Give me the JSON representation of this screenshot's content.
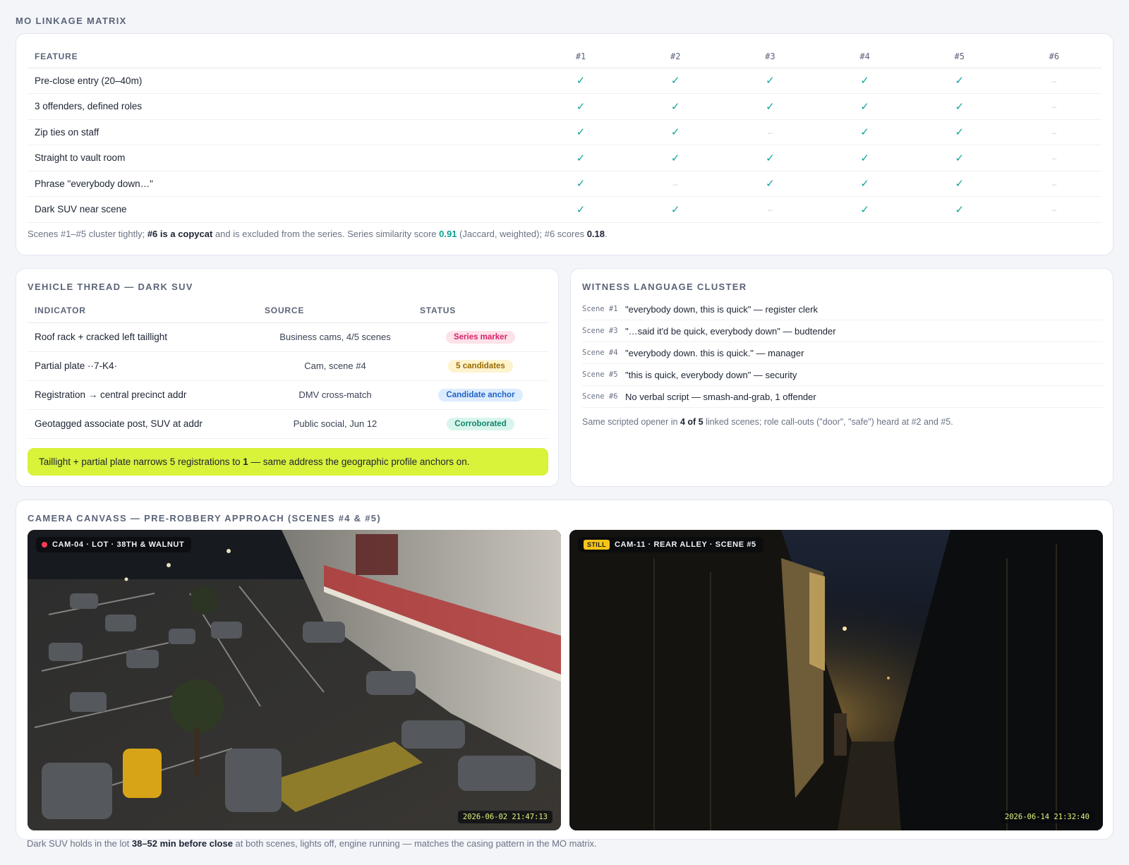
{
  "mo_matrix": {
    "title": "MO LINKAGE MATRIX",
    "columns": [
      "FEATURE",
      "#1",
      "#2",
      "#3",
      "#4",
      "#5",
      "#6"
    ],
    "rows": [
      {
        "feature": "Pre-close entry (20–40m)",
        "marks": [
          true,
          true,
          true,
          true,
          true,
          false
        ]
      },
      {
        "feature": "3 offenders, defined roles",
        "marks": [
          true,
          true,
          true,
          true,
          true,
          false
        ]
      },
      {
        "feature": "Zip ties on staff",
        "marks": [
          true,
          true,
          false,
          true,
          true,
          false
        ]
      },
      {
        "feature": "Straight to vault room",
        "marks": [
          true,
          true,
          true,
          true,
          true,
          false
        ]
      },
      {
        "feature": "Phrase \"everybody down…\"",
        "marks": [
          true,
          false,
          true,
          true,
          true,
          false
        ]
      },
      {
        "feature": "Dark SUV near scene",
        "marks": [
          true,
          true,
          false,
          true,
          true,
          false
        ]
      }
    ],
    "check_glyph": "✓",
    "dash_glyph": "–",
    "note": {
      "t1": "Scenes #1–#5 cluster tightly; ",
      "b1": "#6 is a copycat",
      "t2": " and is excluded from the series. Series similarity score ",
      "score": "0.91",
      "t3": " (Jaccard, weighted); #6 scores ",
      "score6": "0.18",
      "t4": "."
    }
  },
  "vehicle": {
    "title": "VEHICLE THREAD — DARK SUV",
    "headers": {
      "indicator": "INDICATOR",
      "source": "SOURCE",
      "status": "STATUS"
    },
    "rows": [
      {
        "indicator": "Roof rack + cracked left taillight",
        "source": "Business cams, 4/5 scenes",
        "status": "Series marker",
        "status_color": "pink"
      },
      {
        "indicator": "Partial plate ··7-K4·",
        "source": "Cam, scene #4",
        "status": "5 candidates",
        "status_color": "yellow"
      },
      {
        "indicator": "Registration → central precinct addr",
        "source": "DMV cross-match",
        "status": "Candidate anchor",
        "status_color": "blue"
      },
      {
        "indicator": "Geotagged associate post, SUV at addr",
        "source": "Public social, Jun 12",
        "status": "Corroborated",
        "status_color": "green"
      }
    ],
    "callout": {
      "t1": "Taillight + partial plate narrows 5 registrations to ",
      "b1": "1",
      "t2": " — same address the geographic profile anchors on."
    }
  },
  "witness": {
    "title": "WITNESS LANGUAGE CLUSTER",
    "items": [
      {
        "scene": "Scene #1",
        "quote": "\"everybody down, this is quick\" — register clerk"
      },
      {
        "scene": "Scene #3",
        "quote": "\"…said it'd be quick, everybody down\" — budtender"
      },
      {
        "scene": "Scene #4",
        "quote": "\"everybody down. this is quick.\" — manager"
      },
      {
        "scene": "Scene #5",
        "quote": "\"this is quick, everybody down\" — security"
      },
      {
        "scene": "Scene #6",
        "quote": "No verbal script — smash-and-grab, 1 offender"
      }
    ],
    "note": {
      "t1": "Same scripted opener in ",
      "b1": "4 of 5",
      "t2": " linked scenes; role call-outs (\"door\", \"safe\") heard at #2 and #5."
    }
  },
  "camera": {
    "title": "CAMERA CANVASS — PRE-ROBBERY APPROACH (SCENES #4 & #5)",
    "feeds": [
      {
        "label": "CAM-04 · LOT · 38TH & WALNUT",
        "timestamp": "2026-06-02 21:47:13",
        "live": true
      },
      {
        "label": "CAM-11 · REAR ALLEY · SCENE #5",
        "timestamp": "2026-06-14 21:32:40",
        "tag": "STILL"
      }
    ],
    "note": {
      "t1": "Dark SUV holds in the lot ",
      "b1": "38–52 min before close",
      "t2": " at both scenes, lights off, engine running — matches the casing pattern in the MO matrix."
    }
  }
}
